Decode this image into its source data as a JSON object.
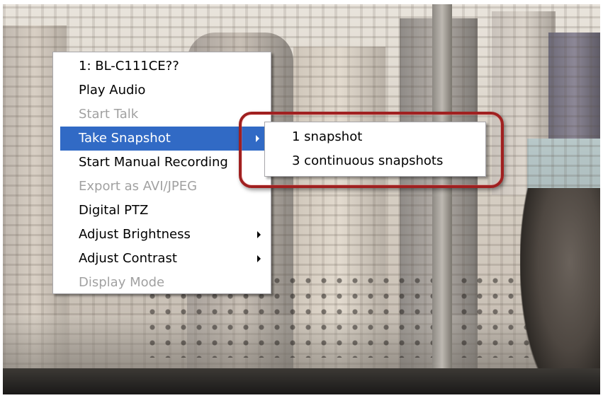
{
  "menu": {
    "items": [
      {
        "label": "1: BL-C111CE??",
        "disabled": false,
        "submenu": false
      },
      {
        "label": "Play Audio",
        "disabled": false,
        "submenu": false
      },
      {
        "label": "Start Talk",
        "disabled": true,
        "submenu": false
      },
      {
        "label": "Take Snapshot",
        "disabled": false,
        "submenu": true,
        "selected": true
      },
      {
        "label": "Start Manual Recording",
        "disabled": false,
        "submenu": false
      },
      {
        "label": "Export as AVI/JPEG",
        "disabled": true,
        "submenu": false
      },
      {
        "label": "Digital PTZ",
        "disabled": false,
        "submenu": false
      },
      {
        "label": "Adjust Brightness",
        "disabled": false,
        "submenu": true
      },
      {
        "label": "Adjust Contrast",
        "disabled": false,
        "submenu": true
      },
      {
        "label": "Display Mode",
        "disabled": true,
        "submenu": false
      }
    ]
  },
  "submenu": {
    "items": [
      {
        "label": "1 snapshot"
      },
      {
        "label": "3 continuous snapshots"
      }
    ]
  },
  "colors": {
    "selection": "#316ac5",
    "disabled_text": "#a1a1a1",
    "highlight": "#a02020"
  },
  "icons": {
    "submenu_arrow": "triangle-right-icon"
  }
}
